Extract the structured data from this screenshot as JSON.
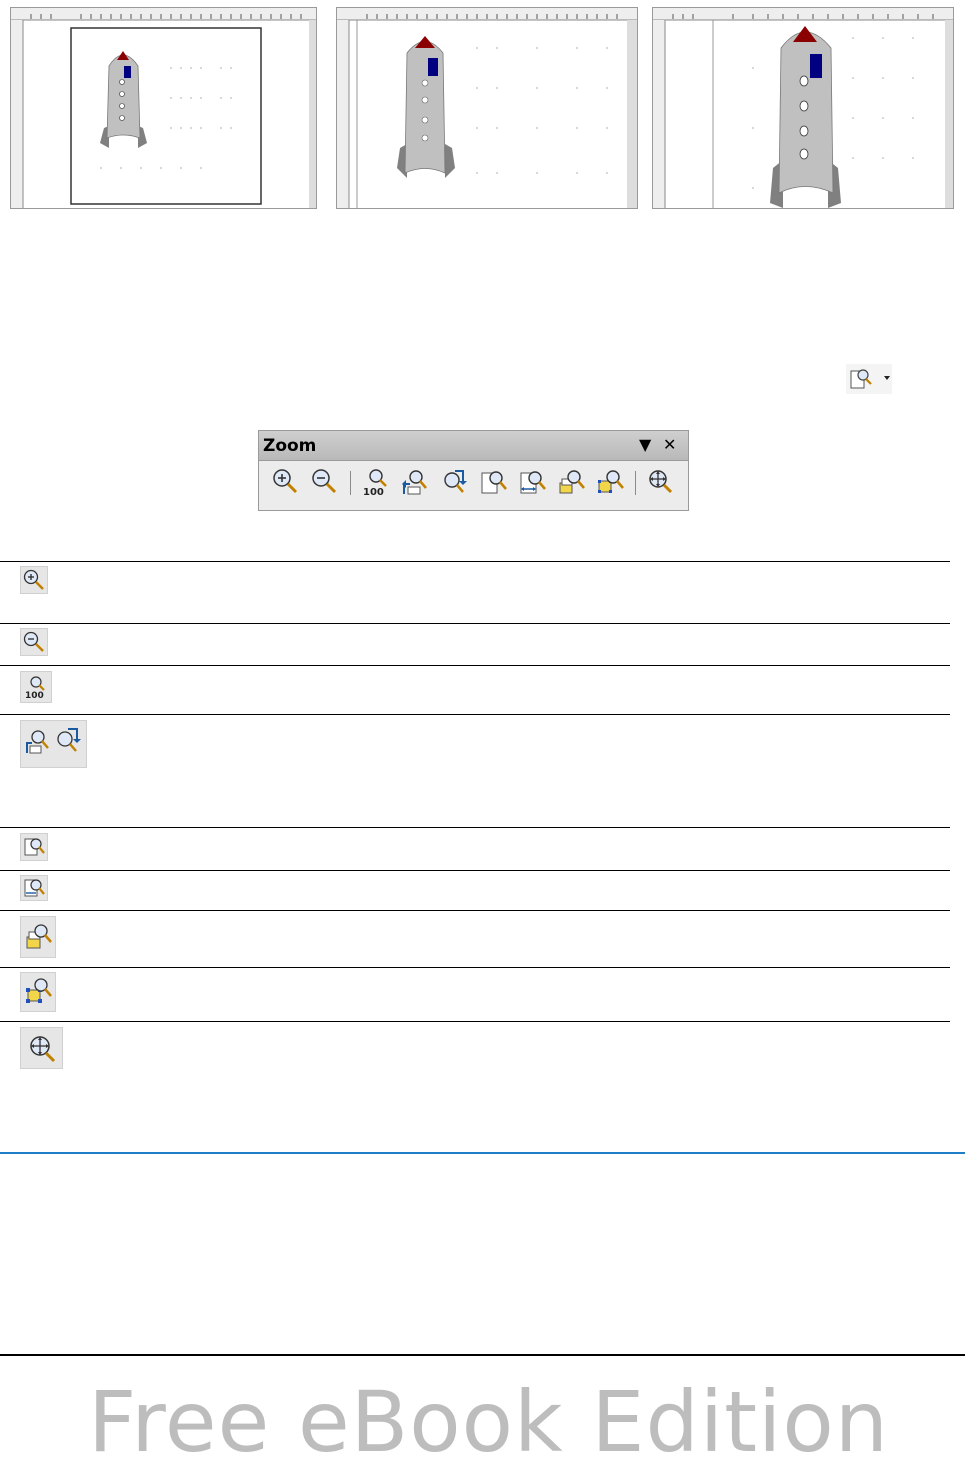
{
  "toolbar": {
    "title": "Zoom"
  },
  "watermark": {
    "text": "Free eBook Edition"
  },
  "icons": {
    "toolbar_buttons": [
      "zoom-in-icon",
      "zoom-out-icon",
      "zoom-100-icon",
      "zoom-previous-icon",
      "zoom-next-icon",
      "entire-page-icon",
      "page-width-icon",
      "optimal-icon",
      "object-zoom-icon",
      "shift-icon"
    ],
    "table_rows": [
      "zoom-in-icon",
      "zoom-out-icon",
      "zoom-100-icon",
      "zoom-previous-next-icons",
      "entire-page-icon",
      "page-width-icon",
      "optimal-icon",
      "object-zoom-icon",
      "shift-icon"
    ]
  },
  "colors": {
    "accent_rule": "#1e7ec8",
    "rocket_body": "#c0c0c0",
    "rocket_nose": "#8b0000",
    "rocket_window": "#000080",
    "rocket_fins": "#808080"
  }
}
